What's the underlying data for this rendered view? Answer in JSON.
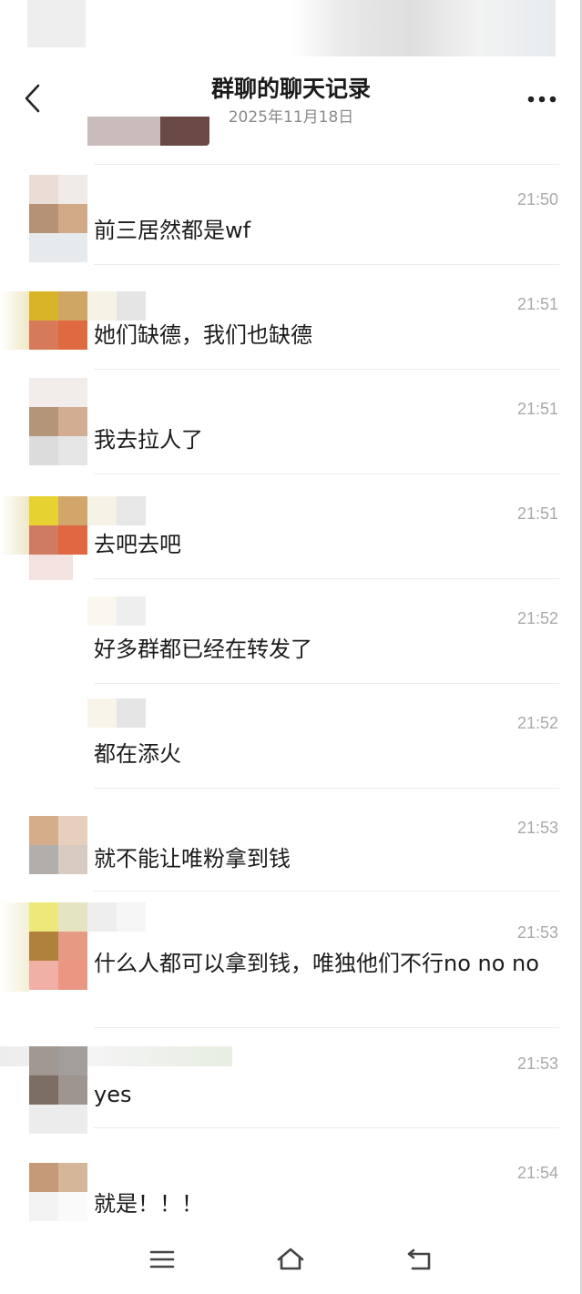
{
  "header": {
    "title": "群聊的聊天记录",
    "date": "2025年11月18日",
    "back_icon": "chevron-left-icon",
    "more_icon": "more-dots-icon"
  },
  "messages": [
    {
      "time": "21:50",
      "text": "前三居然都是wf"
    },
    {
      "time": "21:51",
      "text": "她们缺德，我们也缺德"
    },
    {
      "time": "21:51",
      "text": "我去拉人了"
    },
    {
      "time": "21:51",
      "text": "去吧去吧"
    },
    {
      "time": "21:52",
      "text": "好多群都已经在转发了"
    },
    {
      "time": "21:52",
      "text": "都在添火"
    },
    {
      "time": "21:53",
      "text": "就不能让唯粉拿到钱"
    },
    {
      "time": "21:53",
      "text": "什么人都可以拿到钱，唯独他们不行no no no"
    },
    {
      "time": "21:53",
      "text": "yes"
    },
    {
      "time": "21:54",
      "text": "就是！！！"
    }
  ],
  "nav": {
    "menu_icon": "menu-icon",
    "home_icon": "home-icon",
    "back_icon": "back-arrow-icon"
  },
  "colors": {
    "text": "#1c1c1c",
    "time": "#a9a9a9",
    "divider": "#ececec",
    "subtitle": "#8a8a8a"
  }
}
